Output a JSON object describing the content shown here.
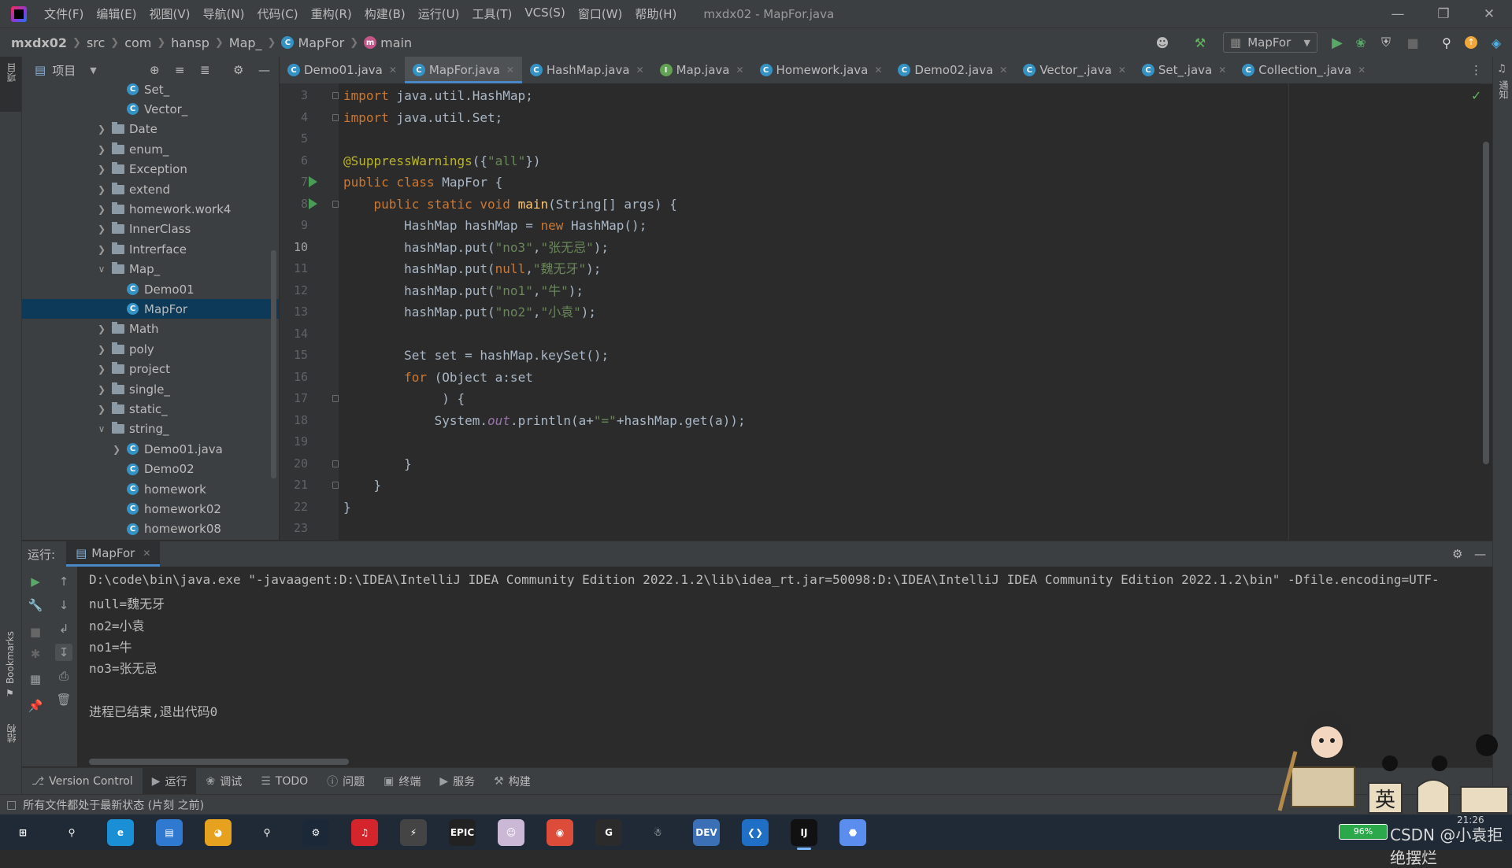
{
  "menubar": {
    "items": [
      "文件(F)",
      "编辑(E)",
      "视图(V)",
      "导航(N)",
      "代码(C)",
      "重构(R)",
      "构建(B)",
      "运行(U)",
      "工具(T)",
      "VCS(S)",
      "窗口(W)",
      "帮助(H)"
    ],
    "window_title": "mxdx02 - MapFor.java"
  },
  "breadcrumb": [
    "mxdx02",
    "src",
    "com",
    "hansp",
    "Map_",
    "MapFor",
    "main"
  ],
  "run_config": "MapFor",
  "left_strip": {
    "project_label": "项目",
    "bookmarks_label": "Bookmarks",
    "structure_label": "结构"
  },
  "right_strip": {
    "notifications_label": "通知"
  },
  "project_panel": {
    "title": "项目",
    "tree": [
      {
        "label": "Set_",
        "kind": "class",
        "depth": 2,
        "expanded": null,
        "selected": false
      },
      {
        "label": "Vector_",
        "kind": "class",
        "depth": 2,
        "expanded": null,
        "selected": false
      },
      {
        "label": "Date",
        "kind": "folder",
        "depth": 1,
        "expanded": false,
        "selected": false
      },
      {
        "label": "enum_",
        "kind": "folder",
        "depth": 1,
        "expanded": false,
        "selected": false
      },
      {
        "label": "Exception",
        "kind": "folder",
        "depth": 1,
        "expanded": false,
        "selected": false
      },
      {
        "label": "extend",
        "kind": "folder",
        "depth": 1,
        "expanded": false,
        "selected": false
      },
      {
        "label": "homework.work4",
        "kind": "folder",
        "depth": 1,
        "expanded": false,
        "selected": false
      },
      {
        "label": "InnerClass",
        "kind": "folder",
        "depth": 1,
        "expanded": false,
        "selected": false
      },
      {
        "label": "Intrerface",
        "kind": "folder",
        "depth": 1,
        "expanded": false,
        "selected": false
      },
      {
        "label": "Map_",
        "kind": "folder",
        "depth": 1,
        "expanded": true,
        "selected": false
      },
      {
        "label": "Demo01",
        "kind": "class",
        "depth": 2,
        "expanded": null,
        "selected": false
      },
      {
        "label": "MapFor",
        "kind": "class",
        "depth": 2,
        "expanded": null,
        "selected": true
      },
      {
        "label": "Math",
        "kind": "folder",
        "depth": 1,
        "expanded": false,
        "selected": false
      },
      {
        "label": "poly",
        "kind": "folder",
        "depth": 1,
        "expanded": false,
        "selected": false
      },
      {
        "label": "project",
        "kind": "folder",
        "depth": 1,
        "expanded": false,
        "selected": false
      },
      {
        "label": "single_",
        "kind": "folder",
        "depth": 1,
        "expanded": false,
        "selected": false
      },
      {
        "label": "static_",
        "kind": "folder",
        "depth": 1,
        "expanded": false,
        "selected": false
      },
      {
        "label": "string_",
        "kind": "folder",
        "depth": 1,
        "expanded": true,
        "selected": false
      },
      {
        "label": "Demo01.java",
        "kind": "class",
        "depth": 2,
        "expanded": false,
        "selected": false
      },
      {
        "label": "Demo02",
        "kind": "class",
        "depth": 2,
        "expanded": null,
        "selected": false
      },
      {
        "label": "homework",
        "kind": "class",
        "depth": 2,
        "expanded": null,
        "selected": false
      },
      {
        "label": "homework02",
        "kind": "class",
        "depth": 2,
        "expanded": null,
        "selected": false
      },
      {
        "label": "homework08",
        "kind": "class",
        "depth": 2,
        "expanded": null,
        "selected": false
      }
    ]
  },
  "editor_tabs": [
    {
      "label": "Demo01.java",
      "icon": "class-icon",
      "active": false
    },
    {
      "label": "MapFor.java",
      "icon": "class-icon",
      "active": true
    },
    {
      "label": "HashMap.java",
      "icon": "class-icon",
      "active": false
    },
    {
      "label": "Map.java",
      "icon": "interface-icon",
      "active": false
    },
    {
      "label": "Homework.java",
      "icon": "class-icon",
      "active": false
    },
    {
      "label": "Demo02.java",
      "icon": "class-icon",
      "active": false
    },
    {
      "label": "Vector_.java",
      "icon": "class-icon",
      "active": false
    },
    {
      "label": "Set_.java",
      "icon": "class-icon",
      "active": false
    },
    {
      "label": "Collection_.java",
      "icon": "class-icon",
      "active": false
    }
  ],
  "editor": {
    "current_line": 10,
    "run_markers": [
      7,
      8
    ],
    "fold_markers": [
      3,
      4,
      8,
      17,
      20,
      21
    ],
    "lines": [
      {
        "n": 3,
        "tokens": [
          [
            "kw",
            "import"
          ],
          [
            "t",
            " java.util.HashMap;"
          ]
        ]
      },
      {
        "n": 4,
        "tokens": [
          [
            "kw",
            "import"
          ],
          [
            "t",
            " java.util.Set;"
          ]
        ]
      },
      {
        "n": 5,
        "tokens": []
      },
      {
        "n": 6,
        "tokens": [
          [
            "ann",
            "@SuppressWarnings"
          ],
          [
            "t",
            "({"
          ],
          [
            "str",
            "\"all\""
          ],
          [
            "t",
            "})"
          ]
        ]
      },
      {
        "n": 7,
        "tokens": [
          [
            "kw",
            "public class"
          ],
          [
            "t",
            " MapFor {"
          ]
        ]
      },
      {
        "n": 8,
        "tokens": [
          [
            "t",
            "    "
          ],
          [
            "kw",
            "public static void"
          ],
          [
            "t",
            " "
          ],
          [
            "fn",
            "main"
          ],
          [
            "t",
            "(String[] args) {"
          ]
        ]
      },
      {
        "n": 9,
        "tokens": [
          [
            "t",
            "        HashMap hashMap = "
          ],
          [
            "kw",
            "new"
          ],
          [
            "t",
            " HashMap();"
          ]
        ]
      },
      {
        "n": 10,
        "tokens": [
          [
            "t",
            "        hashMap.put("
          ],
          [
            "str",
            "\"no3\""
          ],
          [
            "t",
            ","
          ],
          [
            "str",
            "\"张无忌\""
          ],
          [
            "t",
            ");"
          ]
        ]
      },
      {
        "n": 11,
        "tokens": [
          [
            "t",
            "        hashMap.put("
          ],
          [
            "kw",
            "null"
          ],
          [
            "t",
            ","
          ],
          [
            "str",
            "\"魏无牙\""
          ],
          [
            "t",
            ");"
          ]
        ]
      },
      {
        "n": 12,
        "tokens": [
          [
            "t",
            "        hashMap.put("
          ],
          [
            "str",
            "\"no1\""
          ],
          [
            "t",
            ","
          ],
          [
            "str",
            "\"牛\""
          ],
          [
            "t",
            ");"
          ]
        ]
      },
      {
        "n": 13,
        "tokens": [
          [
            "t",
            "        hashMap.put("
          ],
          [
            "str",
            "\"no2\""
          ],
          [
            "t",
            ","
          ],
          [
            "str",
            "\"小袁\""
          ],
          [
            "t",
            ");"
          ]
        ]
      },
      {
        "n": 14,
        "tokens": []
      },
      {
        "n": 15,
        "tokens": [
          [
            "t",
            "        Set set = hashMap.keySet();"
          ]
        ]
      },
      {
        "n": 16,
        "tokens": [
          [
            "t",
            "        "
          ],
          [
            "kw",
            "for"
          ],
          [
            "t",
            " (Object a:set"
          ]
        ]
      },
      {
        "n": 17,
        "tokens": [
          [
            "t",
            "             ) {"
          ]
        ]
      },
      {
        "n": 18,
        "tokens": [
          [
            "t",
            "            System."
          ],
          [
            "fld",
            "out"
          ],
          [
            "t",
            ".println(a+"
          ],
          [
            "str",
            "\"=\""
          ],
          [
            "t",
            "+hashMap.get(a));"
          ]
        ]
      },
      {
        "n": 19,
        "tokens": []
      },
      {
        "n": 20,
        "tokens": [
          [
            "t",
            "        }"
          ]
        ]
      },
      {
        "n": 21,
        "tokens": [
          [
            "t",
            "    }"
          ]
        ]
      },
      {
        "n": 22,
        "tokens": [
          [
            "t",
            "}"
          ]
        ]
      },
      {
        "n": 23,
        "tokens": []
      }
    ]
  },
  "run_panel": {
    "label": "运行:",
    "tab": "MapFor",
    "output": [
      "D:\\code\\bin\\java.exe \"-javaagent:D:\\IDEA\\IntelliJ IDEA Community Edition 2022.1.2\\lib\\idea_rt.jar=50098:D:\\IDEA\\IntelliJ IDEA Community Edition 2022.1.2\\bin\" -Dfile.encoding=UTF-",
      "null=魏无牙",
      "no2=小袁",
      "no1=牛",
      "no3=张无忌",
      "",
      "进程已结束,退出代码0"
    ]
  },
  "tool_tabs": [
    {
      "label": "Version Control",
      "icon": "vcs-icon",
      "active": false
    },
    {
      "label": "运行",
      "icon": "run-icon",
      "active": true
    },
    {
      "label": "调试",
      "icon": "debug-icon",
      "active": false
    },
    {
      "label": "TODO",
      "icon": "todo-icon",
      "active": false
    },
    {
      "label": "问题",
      "icon": "problems-icon",
      "active": false
    },
    {
      "label": "终端",
      "icon": "terminal-icon",
      "active": false
    },
    {
      "label": "服务",
      "icon": "services-icon",
      "active": false
    },
    {
      "label": "构建",
      "icon": "build-icon",
      "active": false
    }
  ],
  "status": {
    "message": "所有文件都处于最新状态 (片刻 之前)"
  },
  "taskbar": {
    "apps": [
      {
        "name": "start-icon",
        "color": "#1f2a36"
      },
      {
        "name": "search-icon",
        "color": "#1f2a36"
      },
      {
        "name": "edge-icon",
        "color": "#1b8fd6"
      },
      {
        "name": "files-icon",
        "color": "#2f7ad0"
      },
      {
        "name": "game-cat-icon",
        "color": "#e6a21e"
      },
      {
        "name": "search-app-icon",
        "color": "#1f2a36"
      },
      {
        "name": "steam-icon",
        "color": "#1b2838"
      },
      {
        "name": "netease-music-icon",
        "color": "#d3252b"
      },
      {
        "name": "bolt-icon",
        "color": "#444"
      },
      {
        "name": "epic-games-icon",
        "color": "#222"
      },
      {
        "name": "anime-app-icon",
        "color": "#cbb8d6"
      },
      {
        "name": "chrome-icon",
        "color": "#dd4b39"
      },
      {
        "name": "g-app-icon",
        "color": "#2b2b2b"
      },
      {
        "name": "qq-icon",
        "color": "#1f2a36"
      },
      {
        "name": "devcpp-icon",
        "color": "#3b6fb6"
      },
      {
        "name": "vscode-icon",
        "color": "#1f6fc7"
      },
      {
        "name": "intellij-icon",
        "color": "#111"
      },
      {
        "name": "polygon-app-icon",
        "color": "#5b8def"
      }
    ],
    "clock": "21:26",
    "watermark": "CSDN @小袁拒绝摆烂",
    "ime_label": "英",
    "battery": "96%"
  }
}
